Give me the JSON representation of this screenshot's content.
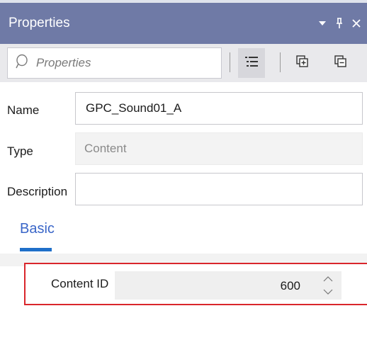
{
  "panel": {
    "title": "Properties",
    "controls": [
      "dropdown-icon",
      "pin-icon",
      "close-icon"
    ]
  },
  "toolbar": {
    "search_placeholder": "Properties",
    "buttons": [
      "categorized-list-icon",
      "expand-all-icon",
      "collapse-all-icon"
    ]
  },
  "fields": {
    "name_label": "Name",
    "name_value": "GPC_Sound01_A",
    "type_label": "Type",
    "type_value": "Content",
    "description_label": "Description",
    "description_value": ""
  },
  "tabs": [
    {
      "label": "Basic",
      "active": true
    }
  ],
  "content_id": {
    "label": "Content ID",
    "value": "600"
  },
  "colors": {
    "titlebar": "#6f7aa6",
    "accent": "#1f6fc9",
    "highlight_border": "#d9262c"
  }
}
